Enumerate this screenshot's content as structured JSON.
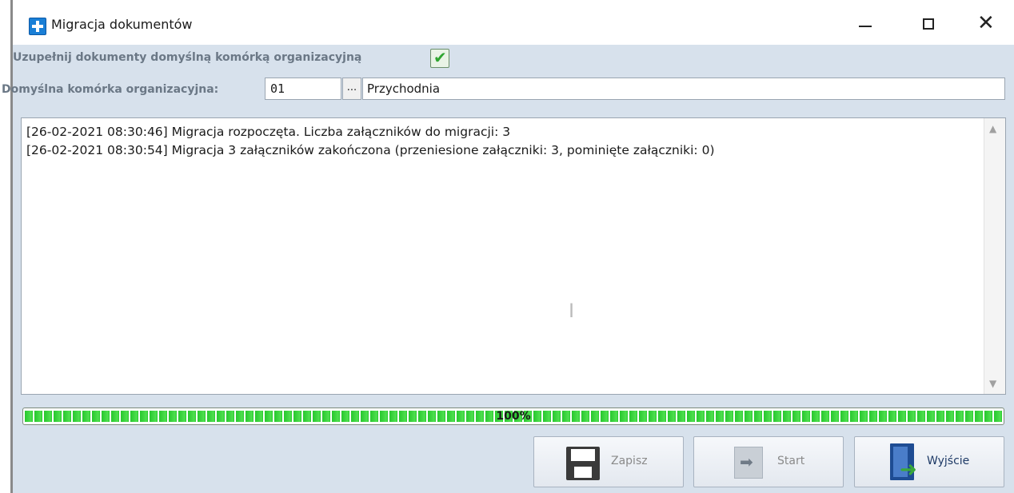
{
  "window": {
    "title": "Migracja dokumentów",
    "minimize_glyph": "",
    "close_glyph": "✕"
  },
  "options": {
    "fill_default_label": "Uzupełnij dokumenty domyślną komórką organizacyjną",
    "fill_default_checked": true,
    "check_glyph": "✔"
  },
  "default_unit": {
    "label": "Domyślna komórka organizacyjna:",
    "code": "01",
    "lookup_label": "...",
    "name": "Przychodnia"
  },
  "log": {
    "lines": [
      "[26-02-2021 08:30:46] Migracja rozpoczęta. Liczba załączników do migracji: 3",
      "[26-02-2021 08:30:54] Migracja 3 załączników zakończona (przeniesione załączniki: 3, pominięte załączniki: 0)"
    ],
    "scroll_up_glyph": "▲",
    "scroll_down_glyph": "▼",
    "cursor_glyph": "I"
  },
  "progress": {
    "value_percent": 100,
    "label": "100%"
  },
  "buttons": {
    "save_label": "Zapisz",
    "start_label": "Start",
    "exit_label": "Wyjście",
    "start_icon_glyph": "➡",
    "exit_icon_glyph": "➜"
  },
  "colors": {
    "content_background": "#d7e1ec",
    "progress_green": "#27c72e",
    "label_gray": "#6b7886",
    "exit_label": "#1e3a66"
  }
}
